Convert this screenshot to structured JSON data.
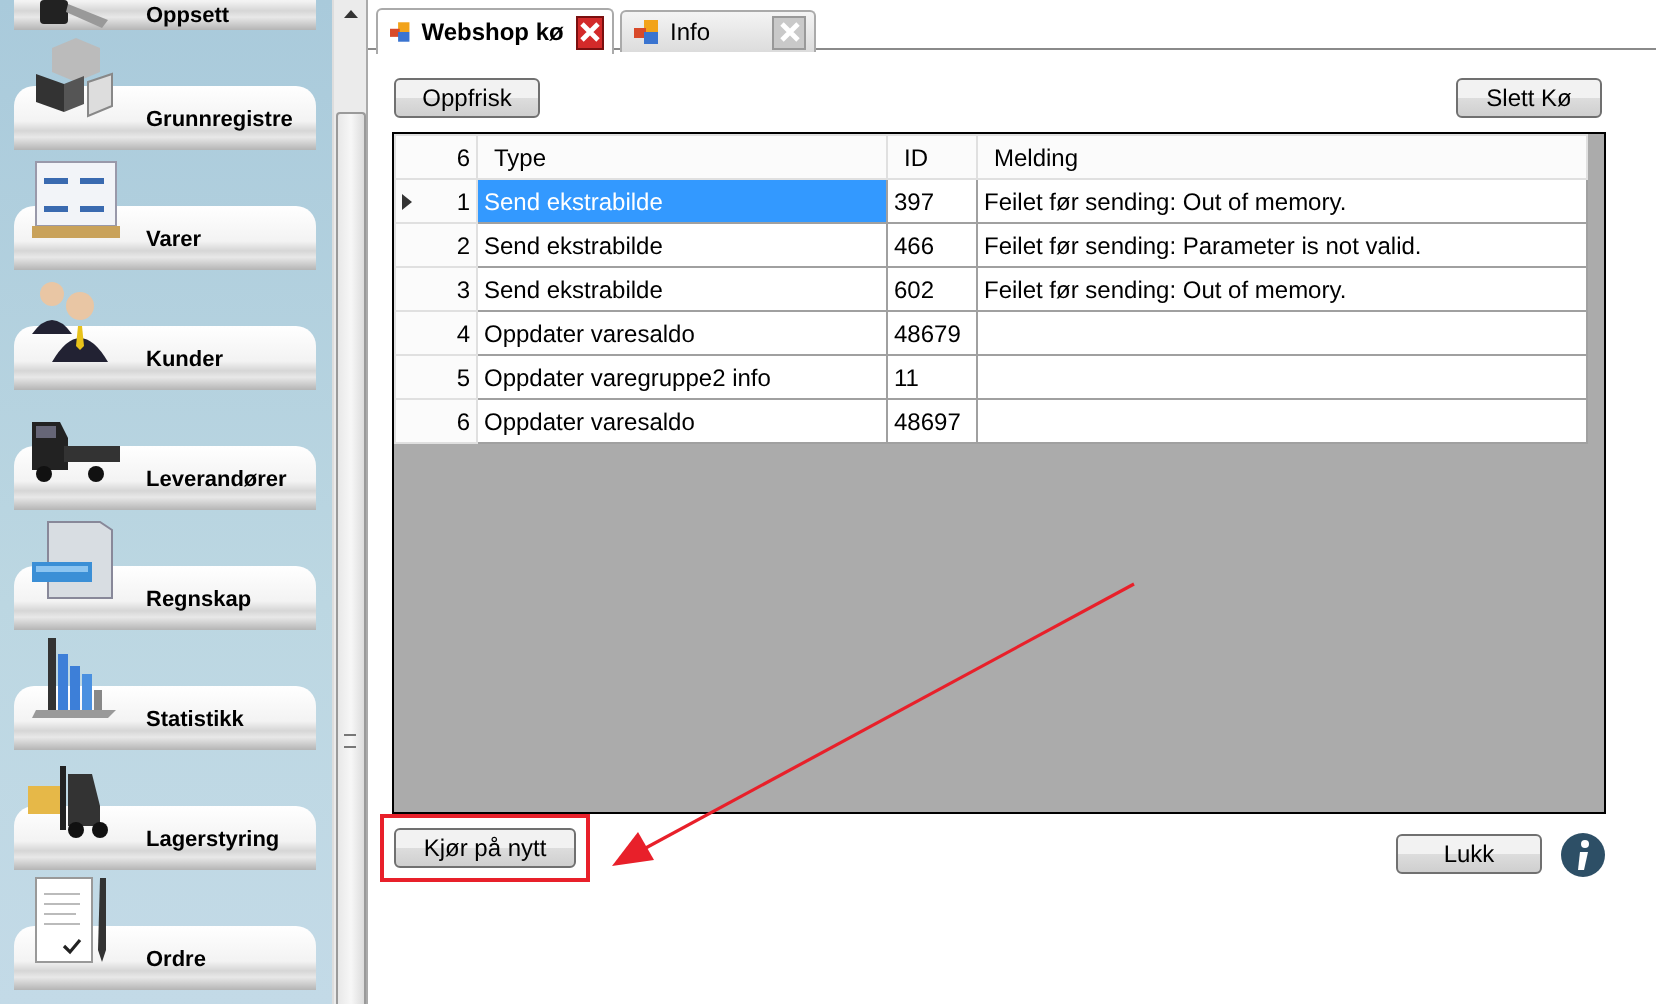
{
  "sidebar": {
    "items": [
      {
        "label": "Oppsett"
      },
      {
        "label": "Grunnregistre"
      },
      {
        "label": "Varer"
      },
      {
        "label": "Kunder"
      },
      {
        "label": "Leverandører"
      },
      {
        "label": "Regnskap"
      },
      {
        "label": "Statistikk"
      },
      {
        "label": "Lagerstyring"
      },
      {
        "label": "Ordre"
      }
    ]
  },
  "tabs": [
    {
      "label": "Webshop kø",
      "selected": true
    },
    {
      "label": "Info",
      "selected": false
    }
  ],
  "toolbar": {
    "refresh_button": "Oppfrisk",
    "clear_button": "Slett Kø"
  },
  "table": {
    "row_count": "6",
    "columns": [
      "Type",
      "ID",
      "Melding"
    ],
    "rows": [
      {
        "number": "1",
        "type": "Send ekstrabilde",
        "id": "397",
        "message": "Feilet før sending: Out of memory.",
        "selected": true
      },
      {
        "number": "2",
        "type": "Send ekstrabilde",
        "id": "466",
        "message": "Feilet før sending: Parameter is not valid.",
        "selected": false
      },
      {
        "number": "3",
        "type": "Send ekstrabilde",
        "id": "602",
        "message": "Feilet før sending: Out of memory.",
        "selected": false
      },
      {
        "number": "4",
        "type": "Oppdater varesaldo",
        "id": "48679",
        "selected": false
      },
      {
        "number": "5",
        "type": "Oppdater varegruppe2 info",
        "id": "11",
        "selected": false
      },
      {
        "number": "6",
        "type": "Oppdater varesaldo",
        "id": "48697",
        "selected": false
      }
    ]
  },
  "footer": {
    "retry_button": "Kjør på nytt",
    "retry_highlighted": true,
    "close_button": "Lukk"
  },
  "annotation_arrow": true
}
